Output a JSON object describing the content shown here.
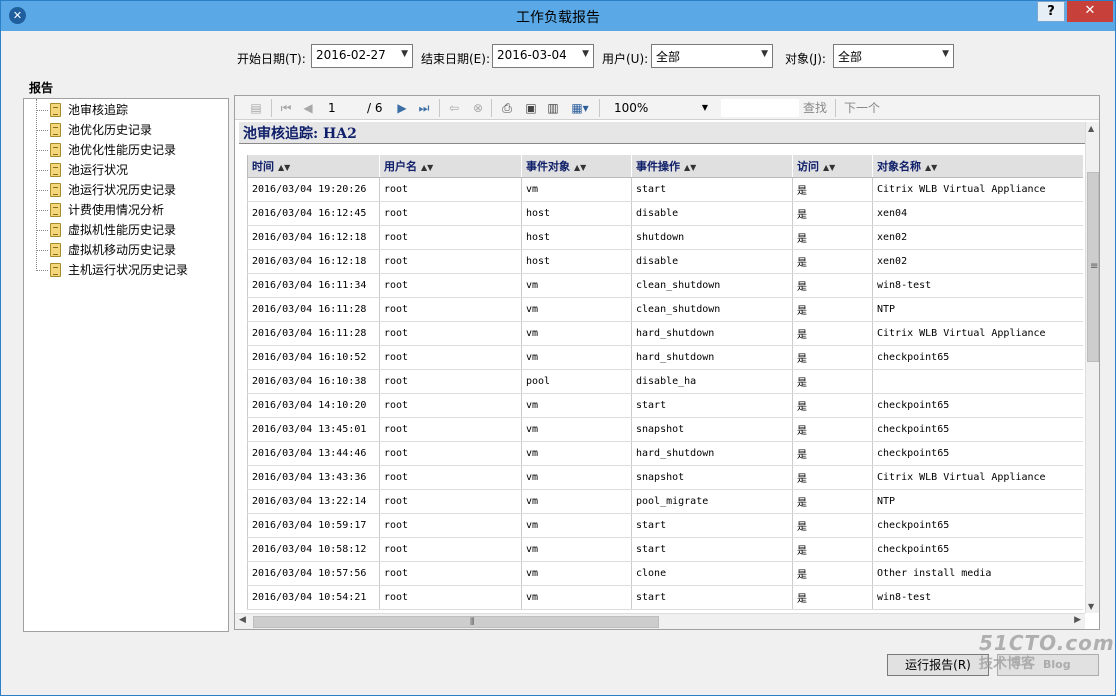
{
  "window": {
    "title": "工作负载报告",
    "help_label": "?",
    "close_label": "✕"
  },
  "filters": {
    "start_label": "开始日期(T):",
    "start_value": "2016-02-27",
    "end_label": "结束日期(E):",
    "end_value": "2016-03-04",
    "user_label": "用户(U):",
    "user_value": "全部",
    "object_label": "对象(J):",
    "object_value": "全部"
  },
  "sidebar": {
    "heading": "报告",
    "items": [
      {
        "label": "池审核追踪"
      },
      {
        "label": "池优化历史记录"
      },
      {
        "label": "池优化性能历史记录"
      },
      {
        "label": "池运行状况"
      },
      {
        "label": "池运行状况历史记录"
      },
      {
        "label": "计费使用情况分析"
      },
      {
        "label": "虚拟机性能历史记录"
      },
      {
        "label": "虚拟机移动历史记录"
      },
      {
        "label": "主机运行状况历史记录"
      }
    ]
  },
  "toolbar": {
    "page_current": "1",
    "page_total": "/ 6",
    "zoom_value": "100%",
    "find_label": "查找",
    "next_label": "下一个"
  },
  "report": {
    "title": "池审核追踪: HA2",
    "columns": [
      "时间",
      "用户名",
      "事件对象",
      "事件操作",
      "访问",
      "对象名称"
    ],
    "rows": [
      [
        "2016/03/04 19:20:26",
        "root",
        "vm",
        "start",
        "是",
        "Citrix WLB Virtual Appliance"
      ],
      [
        "2016/03/04 16:12:45",
        "root",
        "host",
        "disable",
        "是",
        "xen04"
      ],
      [
        "2016/03/04 16:12:18",
        "root",
        "host",
        "shutdown",
        "是",
        "xen02"
      ],
      [
        "2016/03/04 16:12:18",
        "root",
        "host",
        "disable",
        "是",
        "xen02"
      ],
      [
        "2016/03/04 16:11:34",
        "root",
        "vm",
        "clean_shutdown",
        "是",
        "win8-test"
      ],
      [
        "2016/03/04 16:11:28",
        "root",
        "vm",
        "clean_shutdown",
        "是",
        "NTP"
      ],
      [
        "2016/03/04 16:11:28",
        "root",
        "vm",
        "hard_shutdown",
        "是",
        "Citrix WLB Virtual Appliance"
      ],
      [
        "2016/03/04 16:10:52",
        "root",
        "vm",
        "hard_shutdown",
        "是",
        "checkpoint65"
      ],
      [
        "2016/03/04 16:10:38",
        "root",
        "pool",
        "disable_ha",
        "是",
        ""
      ],
      [
        "2016/03/04 14:10:20",
        "root",
        "vm",
        "start",
        "是",
        "checkpoint65"
      ],
      [
        "2016/03/04 13:45:01",
        "root",
        "vm",
        "snapshot",
        "是",
        "checkpoint65"
      ],
      [
        "2016/03/04 13:44:46",
        "root",
        "vm",
        "hard_shutdown",
        "是",
        "checkpoint65"
      ],
      [
        "2016/03/04 13:43:36",
        "root",
        "vm",
        "snapshot",
        "是",
        "Citrix WLB Virtual Appliance"
      ],
      [
        "2016/03/04 13:22:14",
        "root",
        "vm",
        "pool_migrate",
        "是",
        "NTP"
      ],
      [
        "2016/03/04 10:59:17",
        "root",
        "vm",
        "start",
        "是",
        "checkpoint65"
      ],
      [
        "2016/03/04 10:58:12",
        "root",
        "vm",
        "start",
        "是",
        "checkpoint65"
      ],
      [
        "2016/03/04 10:57:56",
        "root",
        "vm",
        "clone",
        "是",
        "Other install media"
      ],
      [
        "2016/03/04 10:54:21",
        "root",
        "vm",
        "start",
        "是",
        "win8-test"
      ]
    ]
  },
  "footer": {
    "run_label": "运行报告(R)"
  },
  "watermark": {
    "line1": "51CTO.com",
    "line2": "技术博客",
    "line3": "Blog"
  }
}
